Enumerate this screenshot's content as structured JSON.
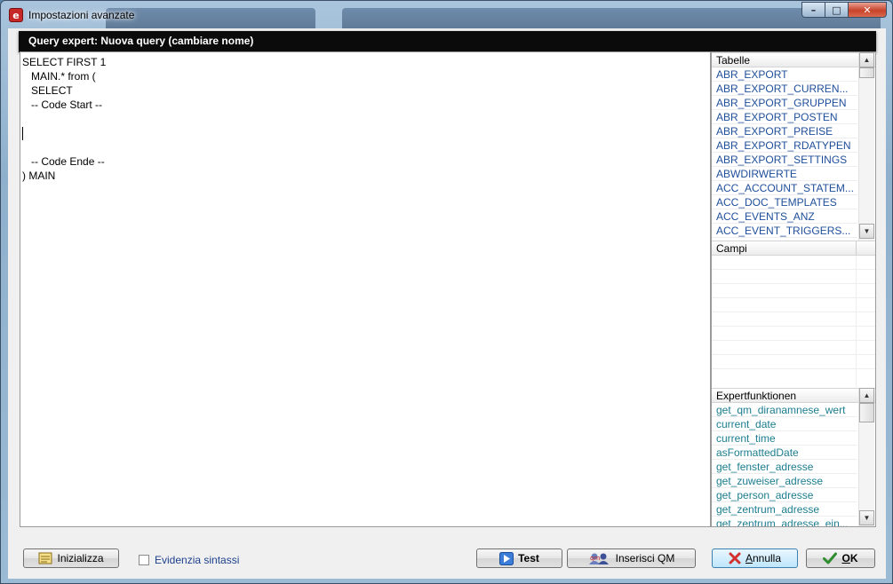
{
  "window": {
    "title": "Impostazioni avanzate",
    "header": "Query expert: Nuova query (cambiare nome)"
  },
  "editor": {
    "lines": [
      "SELECT FIRST 1",
      "   MAIN.* from (",
      "   SELECT",
      "   -- Code Start --",
      "",
      "",
      "",
      "   -- Code Ende --",
      ") MAIN"
    ],
    "caret_line": 5
  },
  "tabelle": {
    "title": "Tabelle",
    "items": [
      "ABR_EXPORT",
      "ABR_EXPORT_CURREN...",
      "ABR_EXPORT_GRUPPEN",
      "ABR_EXPORT_POSTEN",
      "ABR_EXPORT_PREISE",
      "ABR_EXPORT_RDATYPEN",
      "ABR_EXPORT_SETTINGS",
      "ABWDIRWERTE",
      "ACC_ACCOUNT_STATEM...",
      "ACC_DOC_TEMPLATES",
      "ACC_EVENTS_ANZ",
      "ACC_EVENT_TRIGGERS..."
    ]
  },
  "campi": {
    "title": "Campi",
    "items": []
  },
  "expert": {
    "title": "Expertfunktionen",
    "items": [
      "get_qm_diranamnese_wert",
      "current_date",
      "current_time",
      "asFormattedDate",
      "get_fenster_adresse",
      "get_zuweiser_adresse",
      "get_person_adresse",
      "get_zentrum_adresse",
      "get_zentrum_adresse_ein..."
    ]
  },
  "buttons": {
    "inizializza": "Inizializza",
    "test": "Test",
    "inserisci_qm": "Inserisci QM",
    "annulla_pre": "",
    "annulla_acc": "A",
    "annulla_rest": "nnulla",
    "ok_acc": "O",
    "ok_rest": "K"
  },
  "checkbox": {
    "label": "Evidenzia sintassi",
    "checked": false
  },
  "colors": {
    "header_bg": "#0b0b0b",
    "table_link": "#1f4e9a",
    "function_link": "#1b7d8f",
    "cancel_red": "#d32f2f",
    "ok_green": "#2e8b2e"
  }
}
